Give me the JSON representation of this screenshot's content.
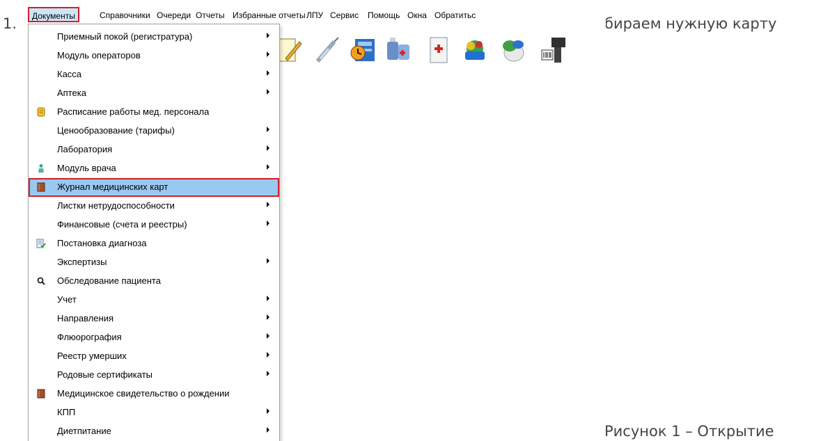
{
  "doc": {
    "step_number": "1.",
    "text_tail": "бираем нужную карту",
    "caption": "Рисунок 1 – Открытие"
  },
  "menubar": {
    "items": [
      "Документы",
      "Справочники",
      "Очереди",
      "Отчеты",
      "Избранные отчеты",
      "ЛПУ",
      "Сервис",
      "Помощь",
      "Окна",
      "Обратитьс"
    ]
  },
  "toolbar": {
    "icons": [
      "notepad-icon",
      "syringe-icon",
      "schedule-icon",
      "pharmacy-icon",
      "medical-kit-icon",
      "cart-icon",
      "pills-icon",
      "barcode-scanner-icon"
    ]
  },
  "dropdown": {
    "items": [
      {
        "label": "Приемный покой (регистратура)",
        "submenu": true
      },
      {
        "label": "Модуль операторов",
        "submenu": true
      },
      {
        "label": "Касса",
        "submenu": true
      },
      {
        "label": "Аптека",
        "submenu": true
      },
      {
        "label": "Расписание работы мед. персонала",
        "submenu": false,
        "icon": "schedule-icon"
      },
      {
        "label": "Ценообразование (тарифы)",
        "submenu": true
      },
      {
        "label": "Лаборатория",
        "submenu": true
      },
      {
        "label": "Модуль врача",
        "submenu": true,
        "icon": "doctor-icon"
      },
      {
        "label": "Журнал медицинских карт",
        "submenu": false,
        "icon": "book-icon",
        "highlighted": true
      },
      {
        "label": "Листки нетрудоспособности",
        "submenu": true
      },
      {
        "label": "Финансовые (счета и реестры)",
        "submenu": true
      },
      {
        "label": "Постановка диагноза",
        "submenu": false,
        "icon": "diagnosis-icon"
      },
      {
        "label": "Экспертизы",
        "submenu": true
      },
      {
        "label": "Обследование пациента",
        "submenu": false,
        "icon": "search-icon"
      },
      {
        "label": "Учет",
        "submenu": true
      },
      {
        "label": "Направления",
        "submenu": true
      },
      {
        "label": "Флюорография",
        "submenu": true
      },
      {
        "label": "Реестр умерших",
        "submenu": true
      },
      {
        "label": "Родовые сертификаты",
        "submenu": true
      },
      {
        "label": "Медицинское свидетельство о рождении",
        "submenu": false,
        "icon": "book-icon"
      },
      {
        "label": "КПП",
        "submenu": true
      },
      {
        "label": "Диетпитание",
        "submenu": true
      }
    ]
  },
  "colors": {
    "highlight_bg": "#99c9f1",
    "highlight_border": "#d0202a",
    "menu_active_bg": "#cce5f7"
  }
}
